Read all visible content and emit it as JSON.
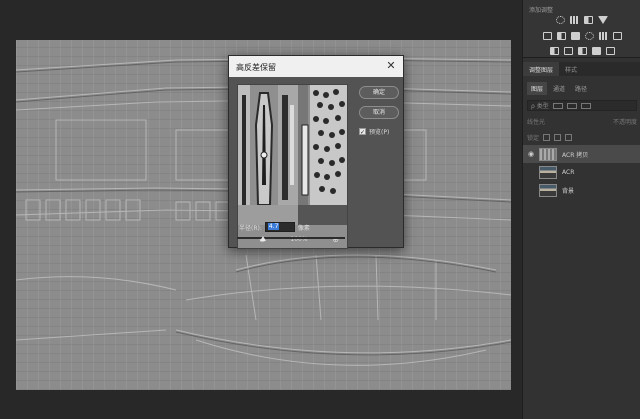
{
  "dialog": {
    "title": "高反差保留",
    "ok_label": "确定",
    "cancel_label": "取消",
    "preview_label": "预览(P)",
    "preview_checked": true,
    "zoom_out_icon": "zoom-out-icon",
    "zoom_in_icon": "zoom-in-icon",
    "zoom_level": "100%",
    "radius_label": "半径(R):",
    "radius_value": "4.7",
    "radius_unit": "像素",
    "radius_slider_fraction": 0.24
  },
  "adjustments_panel": {
    "title": "添加调整"
  },
  "layers_panel": {
    "tabs": [
      "调整图层",
      "样式"
    ],
    "active_tab": 0,
    "sub_tabs": [
      "图层",
      "通道",
      "路径"
    ],
    "active_sub_tab": 0,
    "filter_label": "ρ 类型",
    "blend_mode": "线性光",
    "opacity_label": "不透明度",
    "lock_label": "锁定",
    "layers": [
      {
        "name": "ACR 拷贝",
        "visible": true,
        "selected": true
      },
      {
        "name": "ACR",
        "visible": false,
        "selected": false
      },
      {
        "name": "背景",
        "visible": false,
        "selected": false
      }
    ]
  },
  "colors": {
    "app_bg": "#282828",
    "panel_bg": "#323232",
    "dialog_bg": "#535353",
    "highlight": "#3d7cd6"
  }
}
